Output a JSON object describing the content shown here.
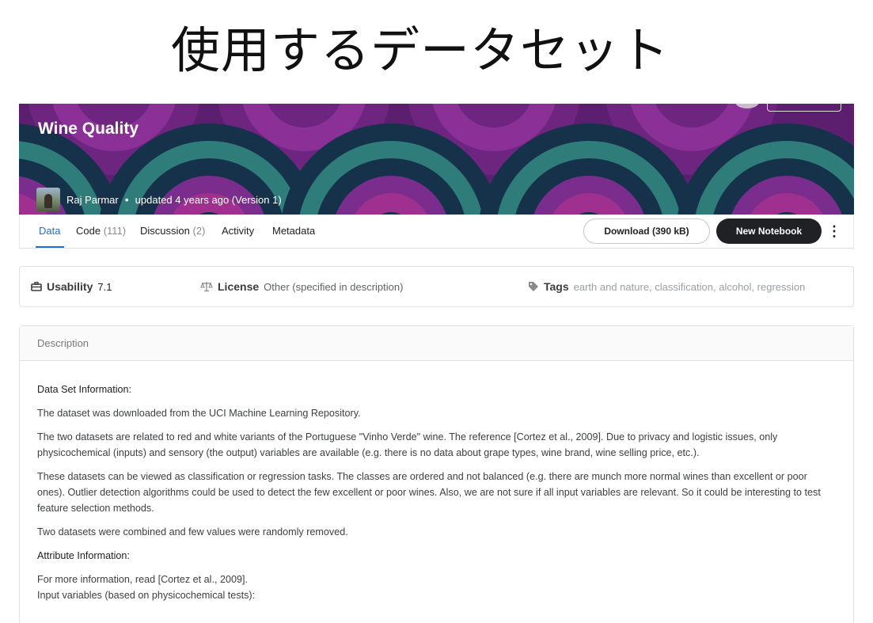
{
  "slide": {
    "title": "使用するデータセット"
  },
  "dataset": {
    "title": "Wine Quality",
    "author": "Raj Parmar",
    "updated": "updated 4 years ago (Version 1)"
  },
  "tabs": [
    {
      "label": "Data",
      "count": ""
    },
    {
      "label": "Code",
      "count": "(111)"
    },
    {
      "label": "Discussion",
      "count": "(2)"
    },
    {
      "label": "Activity",
      "count": ""
    },
    {
      "label": "Metadata",
      "count": ""
    }
  ],
  "actions": {
    "download_label": "Download (390 kB)",
    "new_notebook_label": "New Notebook",
    "more_icon": "⋮"
  },
  "meta": {
    "usability_label": "Usability",
    "usability_value": "7.1",
    "license_label": "License",
    "license_value": "Other (specified in description)",
    "tags_label": "Tags",
    "tags": [
      "earth and nature",
      "classification",
      "alcohol",
      "regression"
    ]
  },
  "description": {
    "header": "Description",
    "paragraphs": [
      "Data Set Information:",
      "The dataset was downloaded from the UCI Machine Learning Repository.",
      "The two datasets are related to red and white variants of the Portuguese \"Vinho Verde\" wine. The reference [Cortez et al., 2009]. Due to privacy and logistic issues, only physicochemical (inputs) and sensory (the output) variables are available (e.g. there is no data about grape types, wine brand, wine selling price, etc.).",
      "These datasets can be viewed as classification or regression tasks. The classes are ordered and not balanced (e.g. there are munch more normal wines than excellent or poor ones). Outlier detection algorithms could be used to detect the few excellent or poor wines. Also, we are not sure if all input variables are relevant. So it could be interesting to test feature selection methods.",
      "Two datasets were combined and few values were randomly removed.",
      "Attribute Information:",
      "For more information, read [Cortez et al., 2009].",
      "Input variables (based on physicochemical tests):"
    ]
  },
  "colors": {
    "accent": "#1e6fd9",
    "dark_button": "#202124",
    "banner_purple": "#7b2d8e",
    "banner_teal": "#2e7d7a",
    "banner_navy": "#16324a"
  }
}
